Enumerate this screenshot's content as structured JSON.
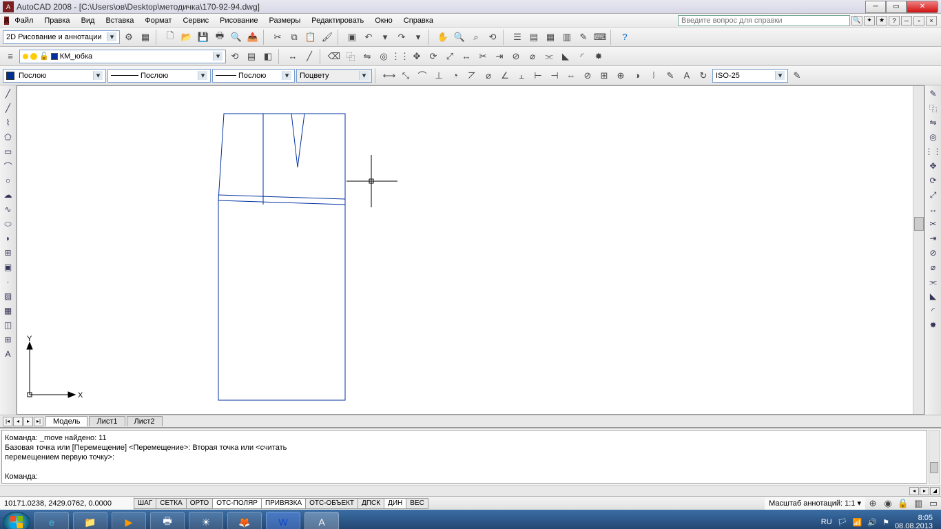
{
  "window": {
    "title": "AutoCAD 2008 - [C:\\Users\\ов\\Desktop\\методичка\\170-92-94.dwg]"
  },
  "menu": {
    "file": "Файл",
    "edit": "Правка",
    "view": "Вид",
    "insert": "Вставка",
    "format": "Формат",
    "service": "Сервис",
    "drawing": "Рисование",
    "dimensions": "Размеры",
    "modify": "Редактировать",
    "window": "Окно",
    "help": "Справка",
    "help_placeholder": "Введите вопрос для справки"
  },
  "workspace": {
    "label": "2D Рисование и аннотации"
  },
  "layer": {
    "current": "КМ_юбка"
  },
  "props": {
    "color": "Послою",
    "linetype": "Послою",
    "lineweight": "Послою",
    "plotstyle": "Поцвету"
  },
  "dimstyle": {
    "current": "ISO-25"
  },
  "tabs": {
    "model": "Модель",
    "layout1": "Лист1",
    "layout2": "Лист2"
  },
  "command": {
    "line1": "Команда: _move найдено: 11",
    "line2": "Базовая точка или [Перемещение] <Перемещение>: Вторая точка или <считать",
    "line3": "перемещением первую точку>:",
    "line4": "",
    "prompt": "Команда:"
  },
  "status": {
    "coords": "10171.0238, 2429.0762, 0.0000",
    "snap": "ШАГ",
    "grid": "СЕТКА",
    "ortho": "ОРТО",
    "polar": "ОТС-ПОЛЯР",
    "osnap": "ПРИВЯЗКА",
    "otrack": "ОТС-ОБЪЕКТ",
    "ducs": "ДПСК",
    "dyn": "ДИН",
    "lwt": "ВЕС",
    "anno_label": "Масштаб аннотаций:",
    "anno_scale": "1:1"
  },
  "taskbar": {
    "lang": "RU",
    "time": "8:05",
    "date": "08.08.2013"
  },
  "ucs": {
    "x": "X",
    "y": "Y"
  }
}
